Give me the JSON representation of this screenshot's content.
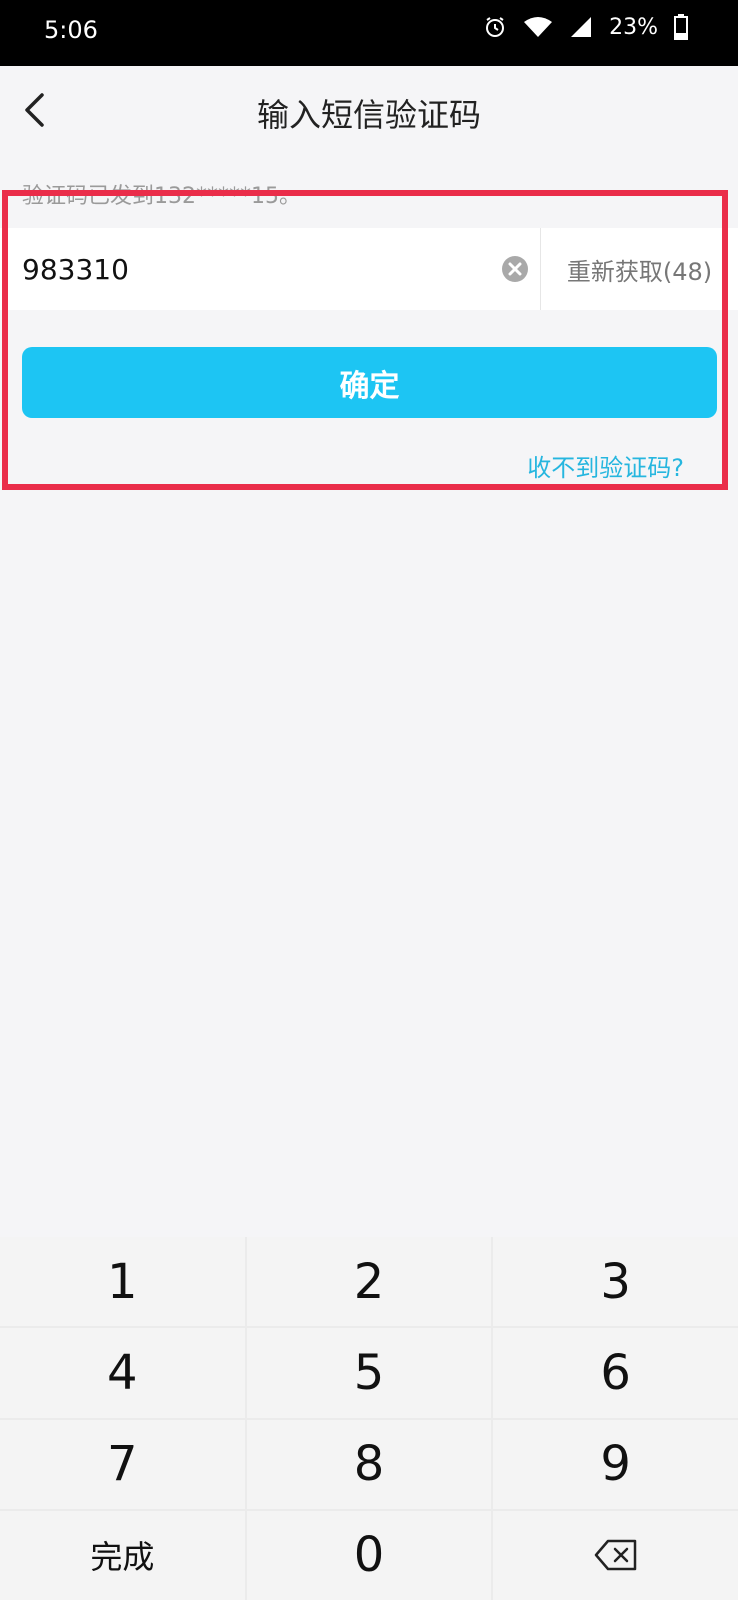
{
  "status_bar": {
    "time": "5:06",
    "battery": "23%"
  },
  "header": {
    "title": "输入短信验证码",
    "back_icon": "chevron-left-icon"
  },
  "sent_info": "验证码已发到132*****15。",
  "code_input": {
    "value": "983310"
  },
  "resend_button": {
    "label": "重新获取(48)"
  },
  "confirm_button": {
    "label": "确定"
  },
  "no_code_link": {
    "label": "收不到验证码?"
  },
  "keypad": {
    "keys": [
      "1",
      "2",
      "3",
      "4",
      "5",
      "6",
      "7",
      "8",
      "9"
    ],
    "done_label": "完成",
    "zero_label": "0",
    "delete_icon": "backspace-icon"
  },
  "colors": {
    "accent": "#1dc5f3",
    "link": "#26b6df",
    "highlight": "#ea2d4a",
    "background": "#f5f5f7"
  }
}
